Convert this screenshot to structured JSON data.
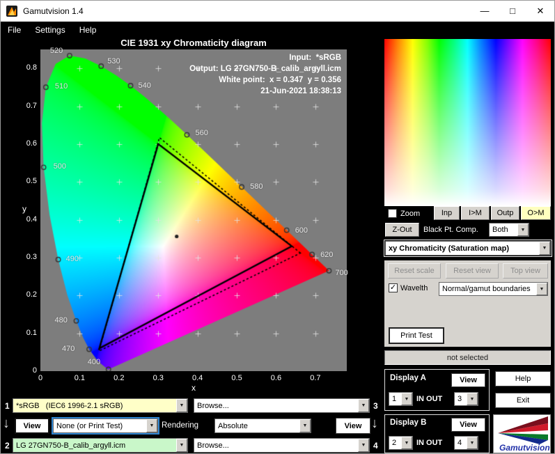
{
  "window": {
    "title": "Gamutvision 1.4"
  },
  "icons": {
    "dropdown_arrow": "▼",
    "check": "✓",
    "arrow_down": "↓",
    "minimize": "—",
    "maximize": "□",
    "close": "✕"
  },
  "menu": {
    "items": [
      {
        "label": "File"
      },
      {
        "label": "Settings"
      },
      {
        "label": "Help"
      }
    ]
  },
  "chart_data": {
    "type": "scatter",
    "title": "CIE 1931 xy Chromaticity diagram",
    "xlabel": "x",
    "ylabel": "y",
    "xlim": [
      0,
      0.78
    ],
    "ylim": [
      0,
      0.85
    ],
    "grid_step": 0.1,
    "x_ticks": [
      {
        "label": "0",
        "value": 0
      },
      {
        "label": "0.1",
        "value": 0.1
      },
      {
        "label": "0.2",
        "value": 0.2
      },
      {
        "label": "0.3",
        "value": 0.3
      },
      {
        "label": "0.4",
        "value": 0.4
      },
      {
        "label": "0.5",
        "value": 0.5
      },
      {
        "label": "0.6",
        "value": 0.6
      },
      {
        "label": "0.7",
        "value": 0.7
      }
    ],
    "y_ticks": [
      {
        "label": "0",
        "value": 0
      },
      {
        "label": "0.1",
        "value": 0.1
      },
      {
        "label": "0.2",
        "value": 0.2
      },
      {
        "label": "0.3",
        "value": 0.3
      },
      {
        "label": "0.4",
        "value": 0.4
      },
      {
        "label": "0.5",
        "value": 0.5
      },
      {
        "label": "0.6",
        "value": 0.6
      },
      {
        "label": "0.7",
        "value": 0.7
      },
      {
        "label": "0.8",
        "value": 0.8
      }
    ],
    "annotations": [
      "Input:  *sRGB",
      "Output: LG 27GN750-B_calib_argyll.icm",
      "White point:  x = 0.347  y = 0.356",
      "21-Jun-2021 18:38:13"
    ],
    "white_point": {
      "x": 0.347,
      "y": 0.356
    },
    "gamuts": [
      {
        "name": "input sRGB",
        "line": "solid",
        "points": [
          [
            0.64,
            0.33
          ],
          [
            0.3,
            0.6
          ],
          [
            0.15,
            0.06
          ]
        ]
      },
      {
        "name": "output LG 27GN750-B",
        "line": "dotted",
        "points": [
          [
            0.662,
            0.312
          ],
          [
            0.303,
            0.617
          ],
          [
            0.149,
            0.053
          ]
        ]
      }
    ],
    "wavelength_markers": [
      {
        "label": "520",
        "x": 0.0743,
        "y": 0.8338,
        "dx": -28,
        "dy": -13
      },
      {
        "label": "530",
        "x": 0.1547,
        "y": 0.8059,
        "dx": 9,
        "dy": -13
      },
      {
        "label": "510",
        "x": 0.0139,
        "y": 0.7502,
        "dx": 13,
        "dy": -7
      },
      {
        "label": "540",
        "x": 0.2296,
        "y": 0.7543,
        "dx": 11,
        "dy": -6
      },
      {
        "label": "500",
        "x": 0.0082,
        "y": 0.5384,
        "dx": 14,
        "dy": -7
      },
      {
        "label": "560",
        "x": 0.3731,
        "y": 0.6245,
        "dx": 12,
        "dy": -9
      },
      {
        "label": "580",
        "x": 0.5125,
        "y": 0.4866,
        "dx": 12,
        "dy": -7
      },
      {
        "label": "490",
        "x": 0.0454,
        "y": 0.295,
        "dx": 11,
        "dy": -7
      },
      {
        "label": "600",
        "x": 0.627,
        "y": 0.3725,
        "dx": 12,
        "dy": -6
      },
      {
        "label": "620",
        "x": 0.6915,
        "y": 0.3083,
        "dx": 12,
        "dy": -5
      },
      {
        "label": "700",
        "x": 0.7347,
        "y": 0.2653,
        "dx": 9,
        "dy": -3
      },
      {
        "label": "480",
        "x": 0.0913,
        "y": 0.1327,
        "dx": -31,
        "dy": -7
      },
      {
        "label": "470",
        "x": 0.1241,
        "y": 0.0578,
        "dx": -39,
        "dy": -7
      },
      {
        "label": "400",
        "x": 0.1733,
        "y": 0.0048,
        "dx": -30,
        "dy": -16
      }
    ],
    "spectral_locus": [
      [
        0.1741,
        0.005
      ],
      [
        0.174,
        0.0049
      ],
      [
        0.1733,
        0.0048
      ],
      [
        0.1726,
        0.0048
      ],
      [
        0.1714,
        0.0051
      ],
      [
        0.1689,
        0.0069
      ],
      [
        0.1644,
        0.0109
      ],
      [
        0.1566,
        0.0177
      ],
      [
        0.144,
        0.0297
      ],
      [
        0.1241,
        0.0578
      ],
      [
        0.1096,
        0.0868
      ],
      [
        0.0913,
        0.1327
      ],
      [
        0.0687,
        0.2007
      ],
      [
        0.0454,
        0.295
      ],
      [
        0.0235,
        0.4127
      ],
      [
        0.0082,
        0.5384
      ],
      [
        0.0039,
        0.6548
      ],
      [
        0.0139,
        0.7502
      ],
      [
        0.0389,
        0.812
      ],
      [
        0.0743,
        0.8338
      ],
      [
        0.1142,
        0.8262
      ],
      [
        0.1547,
        0.8059
      ],
      [
        0.1929,
        0.7816
      ],
      [
        0.2296,
        0.7543
      ],
      [
        0.2658,
        0.7243
      ],
      [
        0.3016,
        0.6923
      ],
      [
        0.3373,
        0.6589
      ],
      [
        0.3731,
        0.6245
      ],
      [
        0.4087,
        0.5896
      ],
      [
        0.4441,
        0.5547
      ],
      [
        0.4788,
        0.5202
      ],
      [
        0.5125,
        0.4866
      ],
      [
        0.5448,
        0.4544
      ],
      [
        0.5752,
        0.4242
      ],
      [
        0.6029,
        0.3965
      ],
      [
        0.627,
        0.3725
      ],
      [
        0.6482,
        0.3514
      ],
      [
        0.6658,
        0.334
      ],
      [
        0.6801,
        0.3197
      ],
      [
        0.6915,
        0.3083
      ],
      [
        0.7079,
        0.292
      ],
      [
        0.719,
        0.2809
      ],
      [
        0.726,
        0.274
      ],
      [
        0.7347,
        0.2653
      ]
    ]
  },
  "right_panel": {
    "zoom_label": "Zoom",
    "inp_button": "Inp",
    "im_button": "I>M",
    "outp_button": "Outp",
    "om_button": "O>M",
    "zout_button": "Z-Out",
    "black_pt_label": "Black Pt. Comp.",
    "black_pt_value": "Both",
    "view_mode_value": "xy Chromaticity (Saturation map)",
    "reset_scale_button": "Reset scale",
    "reset_view_button": "Reset view",
    "top_view_button": "Top view",
    "wavelth_label": "Wavelth",
    "boundaries_value": "Normal/gamut boundaries",
    "print_test_button": "Print Test",
    "status_text": "not selected",
    "display_a": {
      "title": "Display A",
      "view_button": "View",
      "in_value": "1",
      "inout_label": "IN OUT",
      "out_value": "3"
    },
    "display_b": {
      "title": "Display B",
      "view_button": "View",
      "in_value": "2",
      "inout_label": "IN OUT",
      "out_value": "4"
    },
    "help_button": "Help",
    "exit_button": "Exit",
    "logo_text": "Gamutvision"
  },
  "bottom": {
    "slot1_num": "1",
    "input_profile_value": "*sRGB   (IEC6 1996-2.1 sRGB)",
    "browse_top_value": "Browse...",
    "slot3_num": "3",
    "view_left_button": "View",
    "test_pattern_value": "None (or Print Test)",
    "rendering_label": "Rendering",
    "intent_value": "Absolute",
    "view_right_button": "View",
    "slot2_num": "2",
    "output_profile_value": "LG 27GN750-B_calib_argyll.icm",
    "browse_bottom_value": "Browse...",
    "slot4_num": "4"
  }
}
